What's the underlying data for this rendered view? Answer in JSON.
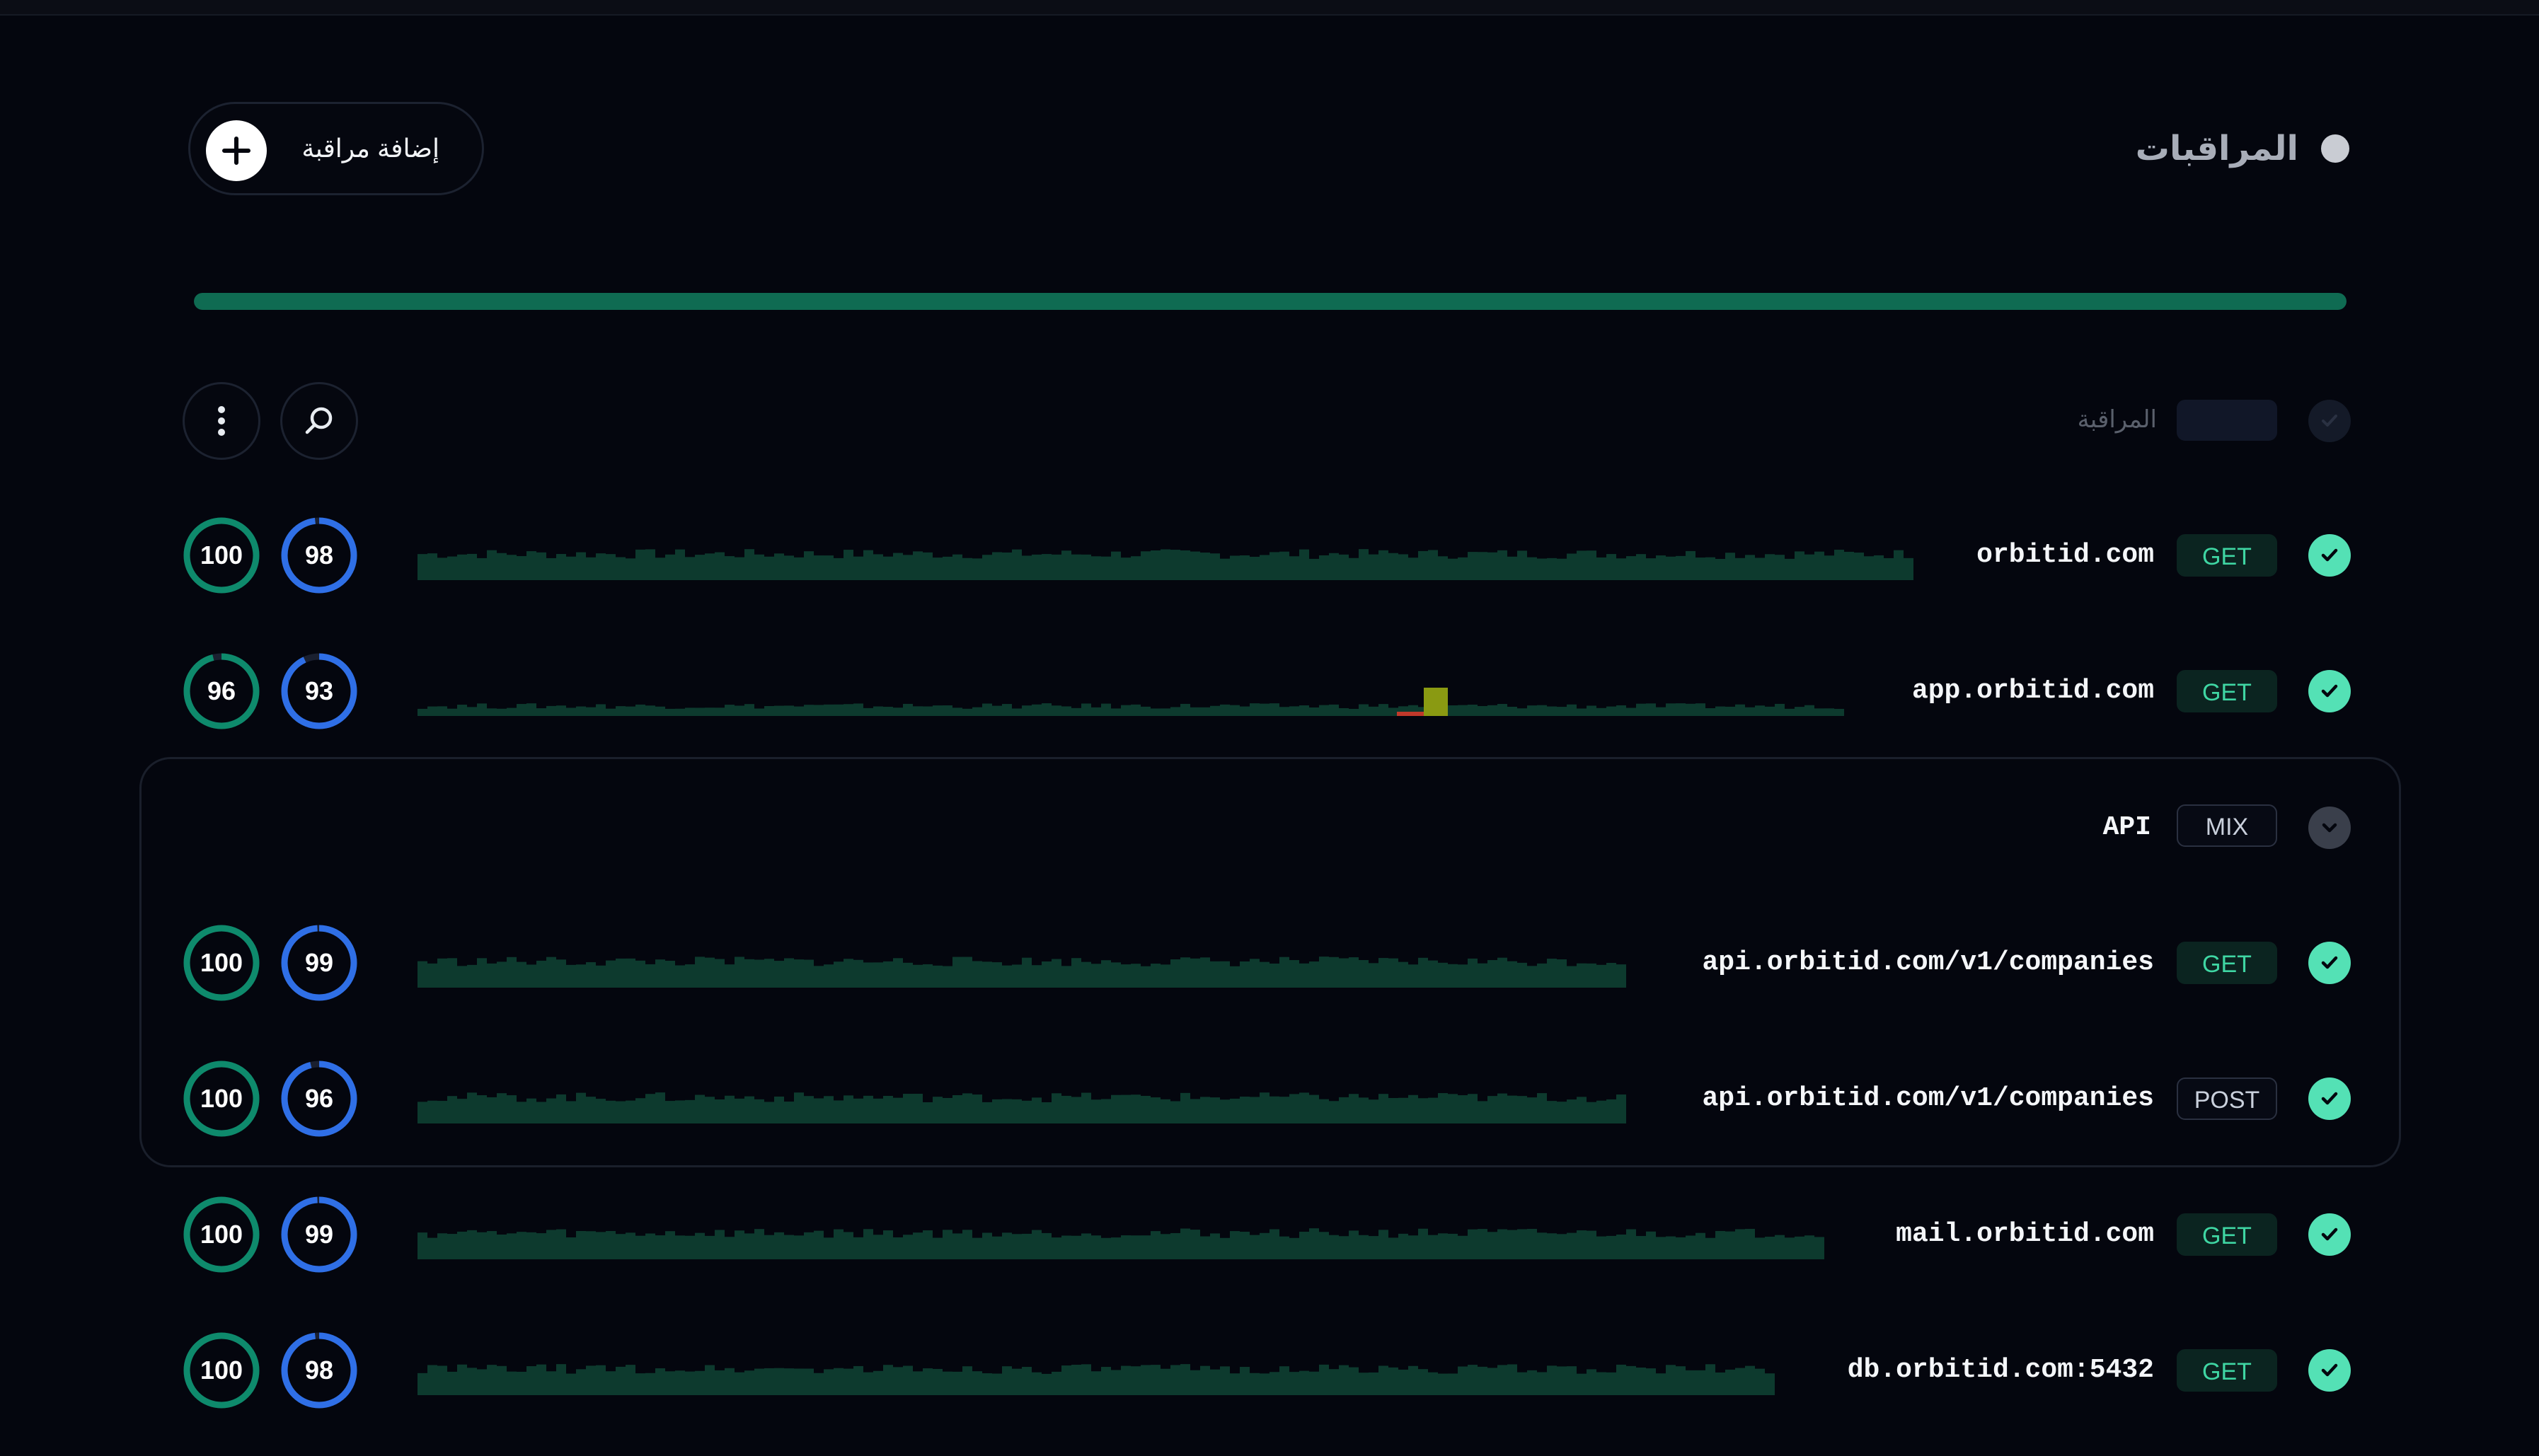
{
  "header": {
    "title": "المراقبات",
    "add_button_label": "إضافة مراقبة"
  },
  "uptime_bar": {
    "percent": 100,
    "color": "#0f6b52"
  },
  "table_header": {
    "monitor_label": "المراقبة"
  },
  "group": {
    "name": "API",
    "method": "MIX"
  },
  "colors": {
    "green_ring": "#0e8a6c",
    "blue_ring": "#2f6fe6",
    "check": "#54e1b5",
    "bar": "#0d3a2e",
    "incident": "#8a9a12",
    "error": "#c0392b"
  },
  "monitors": [
    {
      "url": "orbitid.com",
      "method": "GET",
      "status": "up",
      "score_green": 100,
      "score_blue": 98
    },
    {
      "url": "app.orbitid.com",
      "method": "GET",
      "status": "up",
      "score_green": 96,
      "score_blue": 93
    },
    {
      "url": "api.orbitid.com/v1/companies",
      "method": "GET",
      "status": "up",
      "score_green": 100,
      "score_blue": 99
    },
    {
      "url": "api.orbitid.com/v1/companies",
      "method": "POST",
      "status": "up",
      "score_green": 100,
      "score_blue": 96
    },
    {
      "url": "mail.orbitid.com",
      "method": "GET",
      "status": "up",
      "score_green": 100,
      "score_blue": 99
    },
    {
      "url": "db.orbitid.com:5432",
      "method": "GET",
      "status": "up",
      "score_green": 100,
      "score_blue": 98
    }
  ]
}
